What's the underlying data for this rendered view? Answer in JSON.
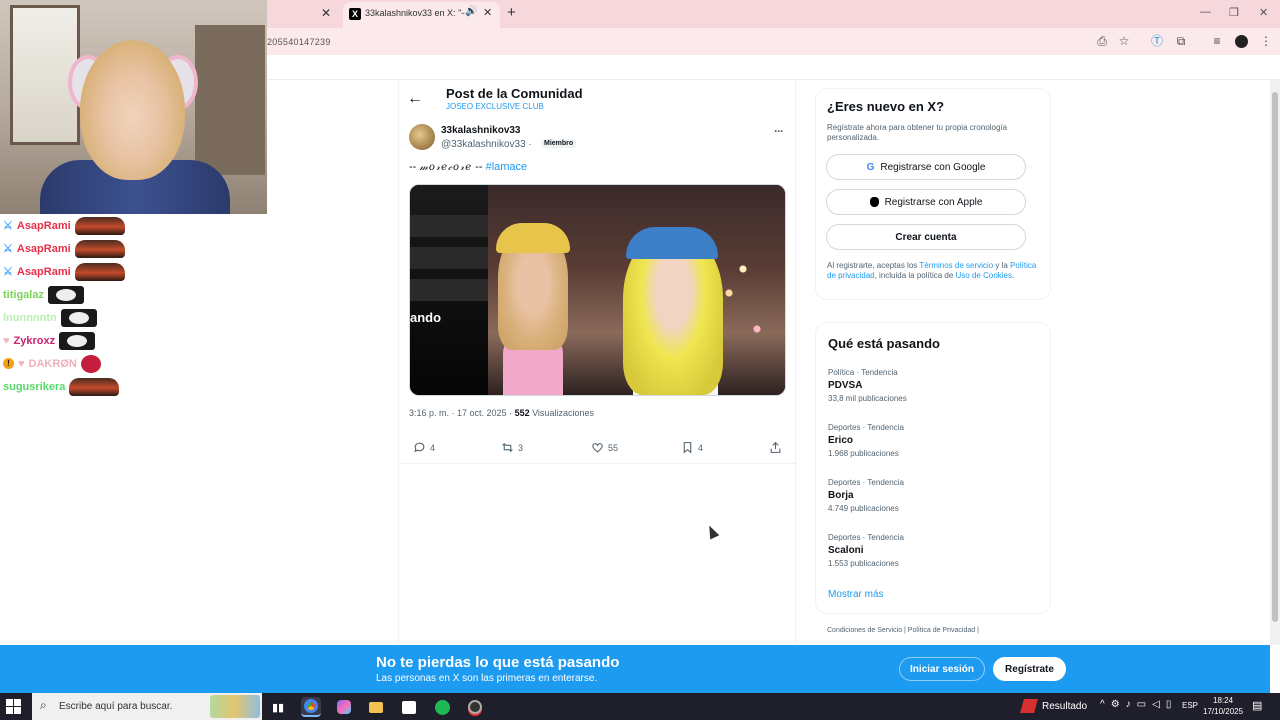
{
  "browser": {
    "tab_title": "33kalashnikov33 en X: \"-- m",
    "url": "205540147239",
    "window_controls": [
      "—",
      "❐",
      "✕"
    ]
  },
  "chat": [
    {
      "name": "AsapRami",
      "color": "#e8304a",
      "badge": "sword",
      "emote": "car"
    },
    {
      "name": "AsapRami",
      "color": "#e8304a",
      "badge": "sword",
      "emote": "car"
    },
    {
      "name": "AsapRami",
      "color": "#e8304a",
      "badge": "sword",
      "emote": "car"
    },
    {
      "name": "titigalaz",
      "color": "#7cd35a",
      "badge": "",
      "emote": "cat"
    },
    {
      "name": "lnunnnntn",
      "color": "#b8f0b0",
      "badge": "",
      "emote": "cat"
    },
    {
      "name": "Zykroxz",
      "color": "#c8246e",
      "badge": "heart",
      "emote": "cat"
    },
    {
      "name": "DAKRØN",
      "color": "#f0b0b8",
      "badge": "warning-heart",
      "emote": "red"
    },
    {
      "name": "sugusrikera",
      "color": "#58d86a",
      "badge": "",
      "emote": "car"
    }
  ],
  "header": {
    "title": "Post de la Comunidad",
    "community": "JOSEO EXCLUSIVE CLUB"
  },
  "post": {
    "name": "33kalashnikov33",
    "handle": "@33kalashnikov33 ·",
    "badge": "Miembro",
    "text_prefix": "-- ",
    "text_styled": "𝓂𝑜𝓇𝑒𝒸𝑜𝓇𝑒",
    "text_suffix": " -- ",
    "hashtag": "#lamace",
    "media_caption": "ando",
    "time": "3:16 p. m. · 17 oct. 2025 · ",
    "views": "552",
    "views_label": " Visualizaciones",
    "replies": "4",
    "reposts": "3",
    "likes": "55",
    "bookmarks": "4"
  },
  "signup": {
    "title": "¿Eres nuevo en X?",
    "desc": "Regístrate ahora para obtener tu propia cronología personalizada.",
    "google": "Registrarse con Google",
    "apple": "Registrarse con Apple",
    "create": "Crear cuenta",
    "legal_1": "Al registrarte, aceptas los ",
    "legal_terms": "Términos de servicio",
    "legal_2": " y la ",
    "legal_privacy": "Política de privacidad",
    "legal_3": ", incluida la política de ",
    "legal_cookies": "Uso de Cookies",
    "legal_4": "."
  },
  "trends": {
    "title": "Qué está pasando",
    "items": [
      {
        "category": "Política · Tendencia",
        "name": "PDVSA",
        "count": "33,8 mil publicaciones"
      },
      {
        "category": "Deportes · Tendencia",
        "name": "Erico",
        "count": "1.968 publicaciones"
      },
      {
        "category": "Deportes · Tendencia",
        "name": "Borja",
        "count": "4.749 publicaciones"
      },
      {
        "category": "Deportes · Tendencia",
        "name": "Scaloni",
        "count": "1.553 publicaciones"
      }
    ],
    "show_more": "Mostrar más"
  },
  "footer": {
    "links": "Condiciones de Servicio  |  Política de Privacidad  |"
  },
  "banner": {
    "title": "No te pierdas lo que está pasando",
    "subtitle": "Las personas en X son las primeras en enterarse.",
    "login": "Iniciar sesión",
    "register": "Regístrate"
  },
  "taskbar": {
    "search_placeholder": "Escribe aquí para buscar.",
    "result_label": "Resultado",
    "lang": "ESP",
    "time": "18:24",
    "date": "17/10/2025"
  },
  "colors": {
    "accent": "#1d9bf0",
    "tabbar": "#f6d7dc"
  }
}
